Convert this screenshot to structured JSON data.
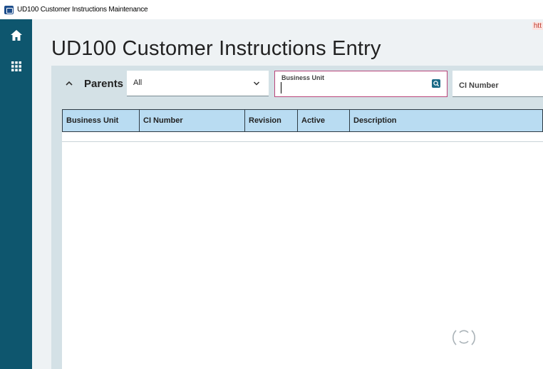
{
  "window": {
    "title": "UD100 Customer Instructions Maintenance",
    "url_fragment": "htt"
  },
  "sidebar": {
    "items": [
      {
        "icon": "home-icon"
      },
      {
        "icon": "apps-grid-icon"
      }
    ]
  },
  "page": {
    "title": "UD100 Customer Instructions Entry"
  },
  "filter": {
    "section_label": "Parents",
    "scope_select_value": "All",
    "business_unit_label": "Business Unit",
    "business_unit_value": "",
    "ci_number_placeholder": "CI Number"
  },
  "grid": {
    "columns": [
      "Business Unit",
      "CI Number",
      "Revision",
      "Active",
      "Description"
    ],
    "rows": []
  },
  "colors": {
    "sidebar": "#0e566e",
    "grid_header": "#b9dcf2",
    "focus_border": "#b9457a",
    "panel": "#d4e1e6"
  }
}
